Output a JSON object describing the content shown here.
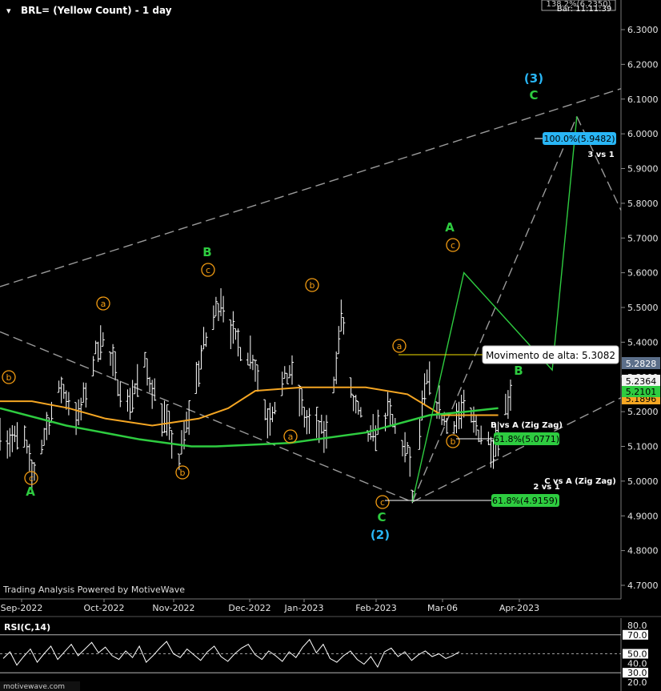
{
  "header": {
    "title": "BRL= (Yellow Count) - 1 day",
    "top_right_label": "138.2%(6.2350)",
    "bar_time": "Bar: 11:11:39"
  },
  "watermark": "Trading Analysis Powered by MotiveWave",
  "brand": "motivewave.com",
  "annotation_box": "Movimento de alta: 5.3082",
  "price_labels": {
    "last": "5.2828",
    "close": "5.2364",
    "green_ma": "5.2101",
    "orange_ma": "5.1896"
  },
  "fib_labels": [
    {
      "label": "100.0%(5.9482)",
      "color": "#29b6f6"
    },
    {
      "label": "61.8%(5.0771)",
      "color": "#2ecc40"
    },
    {
      "label": "61.8%(4.9159)",
      "color": "#2ecc40"
    }
  ],
  "text_annotations": [
    "3 vs 1",
    "B vs A (Zig Zag)",
    "C vs A (Zig Zag)",
    "2 vs 1"
  ],
  "wave_labels": {
    "circled_b_left": "b",
    "a_sep": "a",
    "c_sep": "c",
    "A_sep": "A",
    "c_oct": "c",
    "B_oct": "B",
    "b_oct": "b",
    "a_nov": "a",
    "b_jan": "b",
    "a_jan": "a",
    "c_feb": "c",
    "C_feb": "C",
    "two": "(2)",
    "c_late": "c",
    "A_late": "A",
    "b_late": "b",
    "B_mar": "B",
    "C_apr": "C",
    "three": "(3)"
  },
  "colors": {
    "background": "#000000",
    "price_bars": "#ffffff",
    "ma_orange": "#f5a623",
    "ma_green": "#2ecc40",
    "wave_green": "#2ecc40",
    "wave_cyan": "#29b6f6",
    "wave_orange": "#f39c12",
    "channel": "#9a9a9a",
    "fib_blue": "#29b6f6",
    "fib_green": "#2ecc40",
    "price_last": "#5c6f8a"
  },
  "chart_data": [
    {
      "type": "line",
      "title": "BRL= (Yellow Count) - 1 day",
      "y_axis_side": "right",
      "ylim": [
        4.68,
        6.38
      ],
      "yticks": [
        "6.3000",
        "6.2000",
        "6.1000",
        "6.0000",
        "5.9000",
        "5.8000",
        "5.7000",
        "5.6000",
        "5.5000",
        "5.4000",
        "5.3000",
        "5.2000",
        "5.1000",
        "5.0000",
        "4.9000",
        "4.8000",
        "4.7000"
      ],
      "xticks": [
        "Sep-2022",
        "Oct-2022",
        "Nov-2022",
        "Dec-2022",
        "Jan-2023",
        "Feb-2023",
        "Mar-06",
        "Apr-2023"
      ],
      "x_start": "2022-08-19",
      "x_end": "2023-04-29",
      "grid": false,
      "ohlc_pivots": [
        [
          "2022-08-19",
          5.16
        ],
        [
          "2022-08-22",
          5.12
        ],
        [
          "2022-08-29",
          5.12
        ],
        [
          "2022-09-01",
          5.01
        ],
        [
          "2022-09-08",
          5.18
        ],
        [
          "2022-09-13",
          5.27
        ],
        [
          "2022-09-20",
          5.18
        ],
        [
          "2022-09-29",
          5.42
        ],
        [
          "2022-10-10",
          5.22
        ],
        [
          "2022-10-17",
          5.33
        ],
        [
          "2022-10-31",
          5.06
        ],
        [
          "2022-11-10",
          5.39
        ],
        [
          "2022-11-17",
          5.53
        ],
        [
          "2022-11-23",
          5.4
        ],
        [
          "2022-11-30",
          5.36
        ],
        [
          "2022-12-06",
          5.18
        ],
        [
          "2022-12-15",
          5.32
        ],
        [
          "2022-12-22",
          5.17
        ],
        [
          "2022-12-30",
          5.13
        ],
        [
          "2023-01-04",
          5.4
        ],
        [
          "2023-01-05",
          5.48
        ],
        [
          "2023-01-10",
          5.22
        ],
        [
          "2023-01-17",
          5.12
        ],
        [
          "2023-01-24",
          5.2
        ],
        [
          "2023-02-02",
          5.06
        ],
        [
          "2023-02-03",
          4.94
        ],
        [
          "2023-02-07",
          5.2
        ],
        [
          "2023-02-09",
          5.29
        ],
        [
          "2023-02-17",
          5.16
        ],
        [
          "2023-02-24",
          5.2
        ],
        [
          "2023-03-03",
          5.14
        ],
        [
          "2023-03-08",
          5.1
        ],
        [
          "2023-03-15",
          5.26
        ]
      ],
      "moving_average_orange": [
        [
          "2022-08-19",
          5.23
        ],
        [
          "2022-09-01",
          5.23
        ],
        [
          "2022-09-16",
          5.21
        ],
        [
          "2022-10-01",
          5.18
        ],
        [
          "2022-10-20",
          5.16
        ],
        [
          "2022-11-08",
          5.18
        ],
        [
          "2022-11-20",
          5.21
        ],
        [
          "2022-12-01",
          5.26
        ],
        [
          "2022-12-20",
          5.27
        ],
        [
          "2023-01-15",
          5.27
        ],
        [
          "2023-02-01",
          5.25
        ],
        [
          "2023-02-15",
          5.19
        ],
        [
          "2023-03-10",
          5.19
        ]
      ],
      "moving_average_green": [
        [
          "2022-08-19",
          5.21
        ],
        [
          "2022-09-15",
          5.16
        ],
        [
          "2022-10-15",
          5.12
        ],
        [
          "2022-11-05",
          5.1
        ],
        [
          "2022-11-15",
          5.1
        ],
        [
          "2022-12-15",
          5.11
        ],
        [
          "2023-01-15",
          5.14
        ],
        [
          "2023-02-10",
          5.19
        ],
        [
          "2023-02-25",
          5.2
        ],
        [
          "2023-03-10",
          5.21
        ]
      ],
      "projected_wave": [
        [
          "2023-02-03",
          4.94
        ],
        [
          "2023-02-24",
          5.6
        ],
        [
          "2023-04-01",
          5.32
        ],
        [
          "2023-04-11",
          6.05
        ]
      ],
      "channel_lines": [
        [
          [
            "2022-08-19",
            5.56
          ],
          [
            "2023-04-29",
            6.13
          ]
        ],
        [
          [
            "2022-08-19",
            5.43
          ],
          [
            "2023-02-03",
            4.94
          ]
        ],
        [
          [
            "2023-02-03",
            4.94
          ],
          [
            "2023-04-29",
            5.24
          ]
        ],
        [
          [
            "2023-02-03",
            4.94
          ],
          [
            "2023-04-11",
            6.05
          ]
        ],
        [
          [
            "2023-04-11",
            6.05
          ],
          [
            "2023-04-29",
            5.78
          ]
        ]
      ],
      "fib_levels": [
        {
          "label": "100.0%(5.9482)",
          "value": 5.9482
        },
        {
          "label": "61.8%(5.0771)",
          "value": 5.0771
        },
        {
          "label": "61.8%(4.9159)",
          "value": 4.9159
        }
      ],
      "highlighted_level": {
        "label": "Movimento de alta: 5.3082",
        "value": 5.3082
      }
    },
    {
      "type": "line",
      "title": "RSI(C,14)",
      "ylim": [
        20,
        85
      ],
      "yticks": [
        "80.0",
        "70.0",
        "50.0",
        "40.0",
        "30.0",
        "20.0"
      ],
      "reference_lines": [
        70,
        50,
        30
      ],
      "values": [
        45,
        52,
        38,
        47,
        55,
        41,
        50,
        58,
        44,
        52,
        60,
        48,
        55,
        62,
        51,
        57,
        48,
        44,
        53,
        46,
        58,
        41,
        48,
        56,
        63,
        50,
        46,
        55,
        49,
        43,
        52,
        58,
        47,
        42,
        50,
        56,
        60,
        49,
        44,
        53,
        48,
        42,
        52,
        46,
        57,
        65,
        51,
        60,
        45,
        41,
        48,
        53,
        44,
        39,
        47,
        36,
        52,
        56,
        47,
        52,
        43,
        49,
        53,
        47,
        50,
        45,
        48,
        52
      ]
    }
  ]
}
